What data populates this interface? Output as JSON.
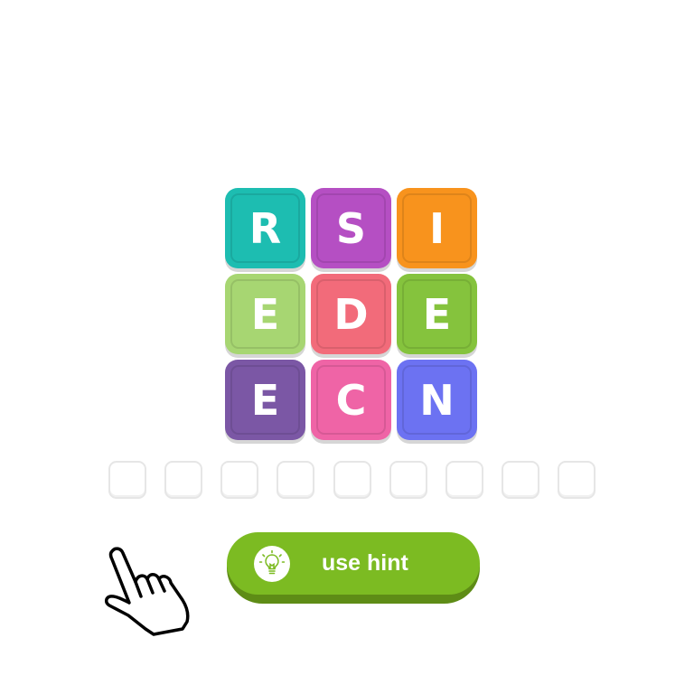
{
  "board": {
    "tiles": [
      {
        "letter": "R",
        "color": "#1dbdb1"
      },
      {
        "letter": "S",
        "color": "#b54fc3"
      },
      {
        "letter": "I",
        "color": "#f8931d"
      },
      {
        "letter": "E",
        "color": "#a7d672"
      },
      {
        "letter": "D",
        "color": "#f26b7a"
      },
      {
        "letter": "E",
        "color": "#85c33d"
      },
      {
        "letter": "E",
        "color": "#7b57a5"
      },
      {
        "letter": "C",
        "color": "#ef64a6"
      },
      {
        "letter": "N",
        "color": "#6c72f2"
      }
    ]
  },
  "answer_slots": {
    "count": 9,
    "filled": [
      "",
      "",
      "",
      "",
      "",
      "",
      "",
      "",
      ""
    ]
  },
  "hint_button": {
    "label": "use hint",
    "icon": "lightbulb-icon",
    "color": "#7cbb22"
  },
  "pointer": {
    "icon": "pointing-hand-icon"
  }
}
